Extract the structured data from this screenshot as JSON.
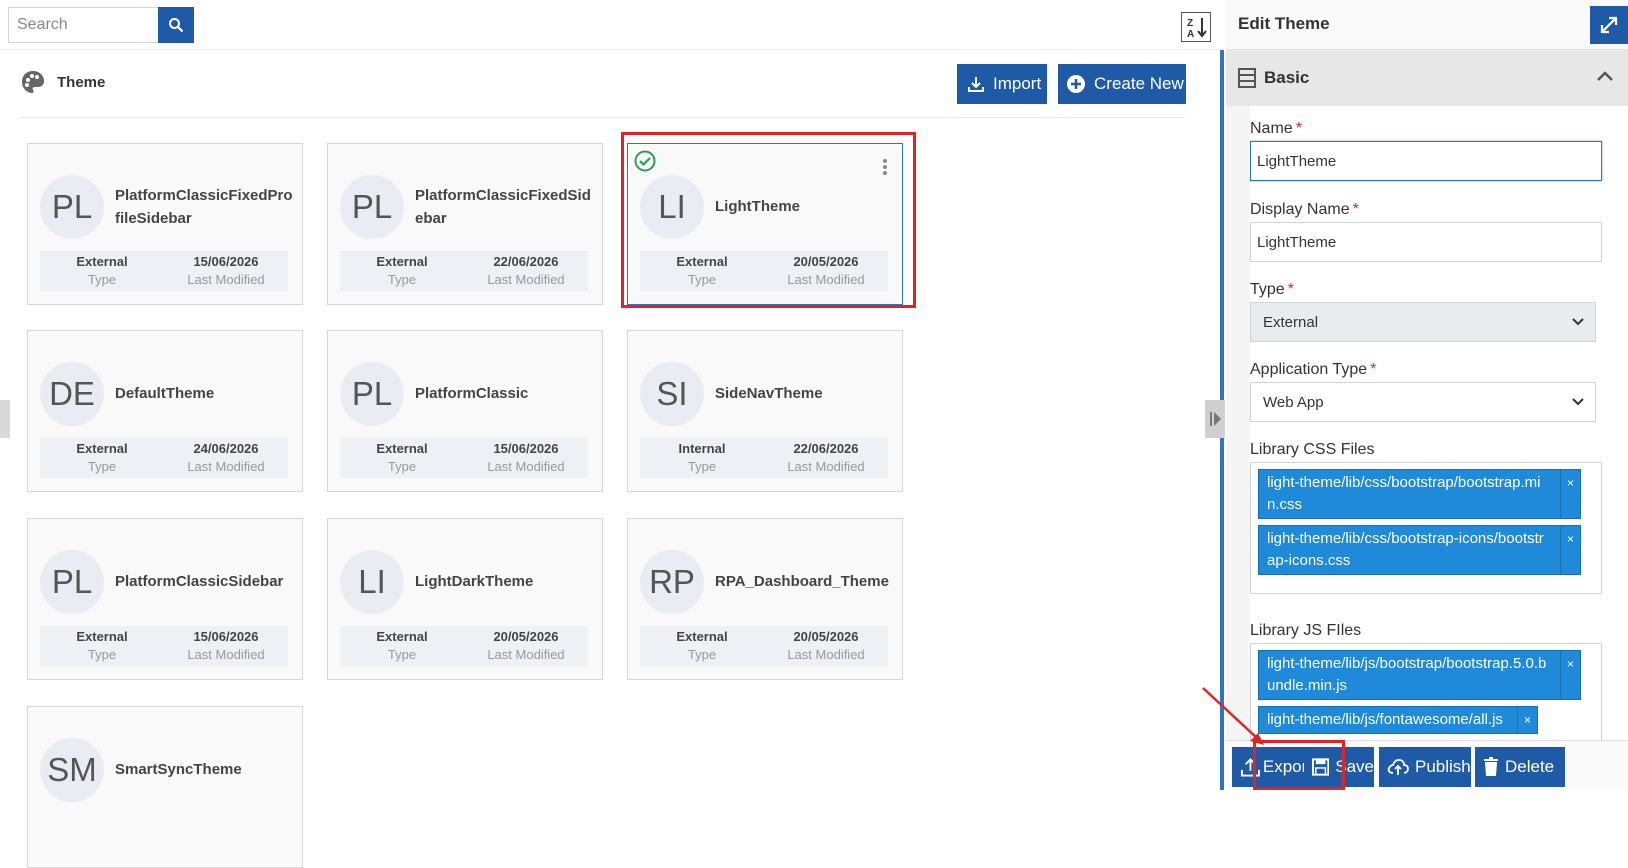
{
  "search": {
    "placeholder": "Search"
  },
  "header": {
    "title": "Theme",
    "import_label": "Import",
    "create_label": "Create New"
  },
  "meta_labels": {
    "type": "Type",
    "modified": "Last Modified"
  },
  "cards": [
    {
      "initials": "PL",
      "name": "PlatformClassicFixedProfileSidebar",
      "type": "External",
      "modified": "15/06/2026"
    },
    {
      "initials": "PL",
      "name": "PlatformClassicFixedSidebar",
      "type": "External",
      "modified": "22/06/2026"
    },
    {
      "initials": "LI",
      "name": "LightTheme",
      "type": "External",
      "modified": "20/05/2026"
    },
    {
      "initials": "DE",
      "name": "DefaultTheme",
      "type": "External",
      "modified": "24/06/2026"
    },
    {
      "initials": "PL",
      "name": "PlatformClassic",
      "type": "External",
      "modified": "15/06/2026"
    },
    {
      "initials": "SI",
      "name": "SideNavTheme",
      "type": "Internal",
      "modified": "22/06/2026"
    },
    {
      "initials": "PL",
      "name": "PlatformClassicSidebar",
      "type": "External",
      "modified": "15/06/2026"
    },
    {
      "initials": "LI",
      "name": "LightDarkTheme",
      "type": "External",
      "modified": "20/05/2026"
    },
    {
      "initials": "RP",
      "name": "RPA_Dashboard_Theme",
      "type": "External",
      "modified": "20/05/2026"
    },
    {
      "initials": "SM",
      "name": "SmartSyncTheme",
      "type": "",
      "modified": ""
    }
  ],
  "panel": {
    "title": "Edit Theme",
    "section": "Basic",
    "fields": {
      "name_label": "Name",
      "name_value": "LightTheme",
      "display_label": "Display Name",
      "display_value": "LightTheme",
      "type_label": "Type",
      "type_value": "External",
      "app_type_label": "Application Type",
      "app_type_value": "Web App",
      "css_label": "Library CSS Files",
      "css_files": [
        "light-theme/lib/css/bootstrap/bootstrap.min.css",
        "light-theme/lib/css/bootstrap-icons/bootstrap-icons.css"
      ],
      "js_label": "Library JS FIles",
      "js_files": [
        "light-theme/lib/js/bootstrap/bootstrap.5.0.bundle.min.js",
        "light-theme/lib/js/fontawesome/all.js"
      ]
    },
    "footer": {
      "export": "Export",
      "save": "Save",
      "publish": "Publish",
      "delete": "Delete"
    }
  },
  "colors": {
    "primary": "#1f5aa6",
    "tag": "#1f8ad9",
    "highlight": "#e02424",
    "success": "#2e9a57"
  }
}
